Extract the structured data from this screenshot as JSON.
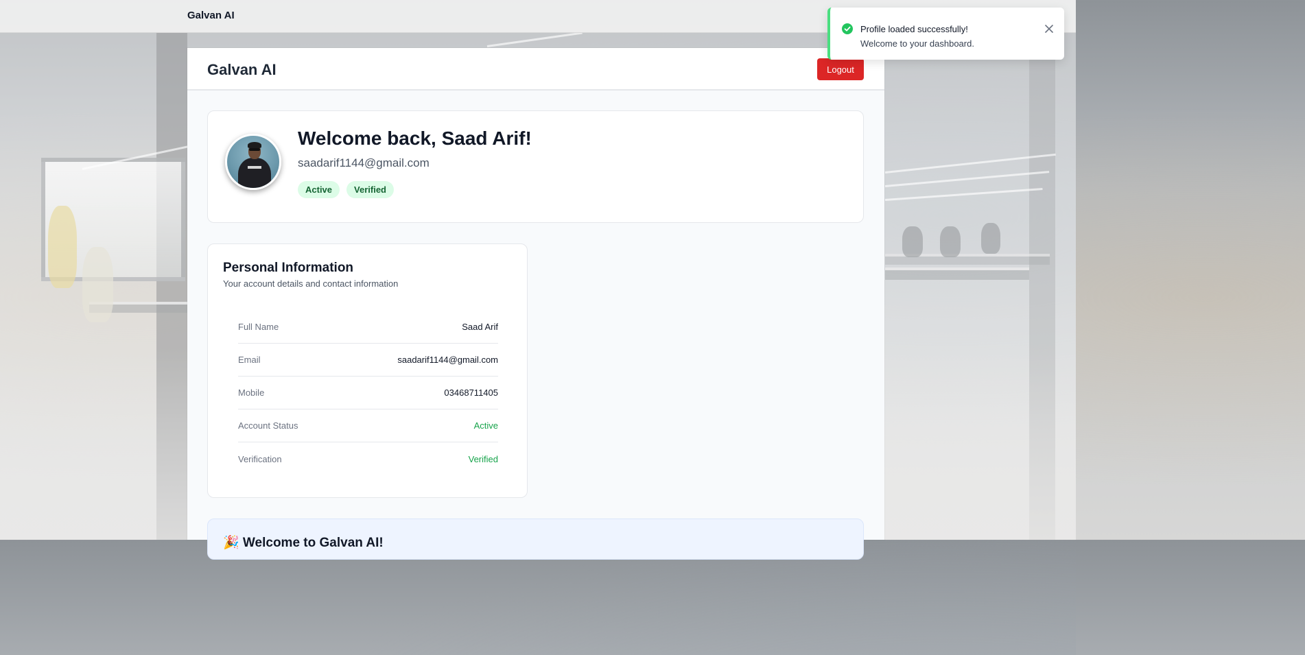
{
  "topbar": {
    "brand": "Galvan AI"
  },
  "header": {
    "title": "Galvan AI",
    "logout_label": "Logout"
  },
  "profile": {
    "welcome": "Welcome back, Saad Arif!",
    "email": "saadarif1144@gmail.com",
    "badges": [
      "Active",
      "Verified"
    ]
  },
  "personal_info": {
    "title": "Personal Information",
    "subtitle": "Your account details and contact information",
    "rows": [
      {
        "label": "Full Name",
        "value": "Saad Arif"
      },
      {
        "label": "Email",
        "value": "saadarif1144@gmail.com"
      },
      {
        "label": "Mobile",
        "value": "03468711405"
      },
      {
        "label": "Account Status",
        "value": "Active"
      },
      {
        "label": "Verification",
        "value": "Verified"
      }
    ]
  },
  "banner": {
    "title": "🎉 Welcome to Galvan AI!"
  },
  "toast": {
    "title": "Profile loaded successfully!",
    "message": "Welcome to your dashboard.",
    "icon": "check-circle-icon",
    "close_icon": "close-icon"
  },
  "colors": {
    "danger": "#dc2626",
    "success": "#16a34a",
    "badge_bg": "#dcfce7",
    "badge_text": "#166534"
  }
}
